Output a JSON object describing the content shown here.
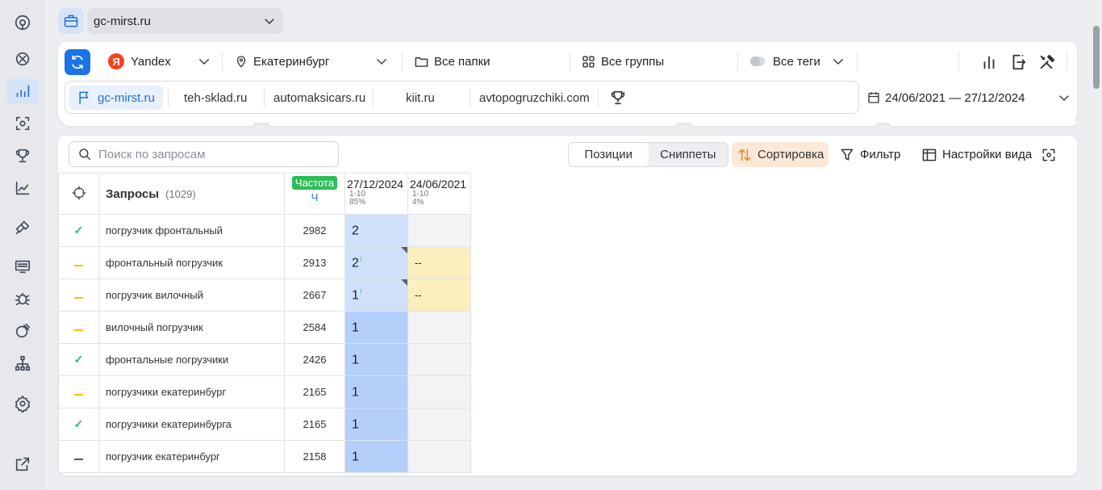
{
  "project": {
    "name": "gc-mirst.ru"
  },
  "filters": {
    "engine": "Yandex",
    "region": "Екатеринбург",
    "folders": "Все папки",
    "groups": "Все группы",
    "tags": "Все теги"
  },
  "domains": [
    "gc-mirst.ru",
    "teh-sklad.ru",
    "automaksicars.ru",
    "kiit.ru",
    "avtopogruzchiki.com"
  ],
  "date_range": "24/06/2021 — 27/12/2024",
  "toolbar": {
    "search_placeholder": "Поиск по запросам",
    "tab_positions": "Позиции",
    "tab_snippets": "Сниппеты",
    "sort": "Сортировка",
    "filter": "Фильтр",
    "view_settings": "Настройки вида"
  },
  "table": {
    "queries_header": "Запросы",
    "queries_count": "(1029)",
    "freq_header": "Частота",
    "freq_sub": "Ч",
    "date1": {
      "date": "27/12/2024",
      "range": "1-10",
      "pct": "85%"
    },
    "date2": {
      "date": "24/06/2021",
      "range": "1-10",
      "pct": "4%"
    },
    "rows": [
      {
        "status": "check",
        "query": "погрузчик фронтальный",
        "freq": "2982",
        "p1": "2",
        "p1_up": "",
        "p2": ""
      },
      {
        "status": "yellow",
        "query": "фронтальный погрузчик",
        "freq": "2913",
        "p1": "2",
        "p1_up": "↑",
        "p2": "--"
      },
      {
        "status": "yellow",
        "query": "погрузчик вилочный",
        "freq": "2667",
        "p1": "1",
        "p1_up": "↑",
        "p2": "--"
      },
      {
        "status": "yellow",
        "query": "вилочный погрузчик",
        "freq": "2584",
        "p1": "1",
        "p1_up": "",
        "p2": ""
      },
      {
        "status": "check",
        "query": "фронтальные погрузчики",
        "freq": "2426",
        "p1": "1",
        "p1_up": "",
        "p2": ""
      },
      {
        "status": "yellow",
        "query": "погрузчики екатеринбург",
        "freq": "2165",
        "p1": "1",
        "p1_up": "",
        "p2": ""
      },
      {
        "status": "check",
        "query": "погрузчики екатеринбурга",
        "freq": "2165",
        "p1": "1",
        "p1_up": "",
        "p2": ""
      },
      {
        "status": "gray",
        "query": "погрузчик екатеринбург",
        "freq": "2158",
        "p1": "1",
        "p1_up": "",
        "p2": ""
      }
    ]
  },
  "colors": {
    "accent": "#1a73e8",
    "freq_badge": "#2ebd59",
    "sort_bg": "#fde8d7"
  }
}
